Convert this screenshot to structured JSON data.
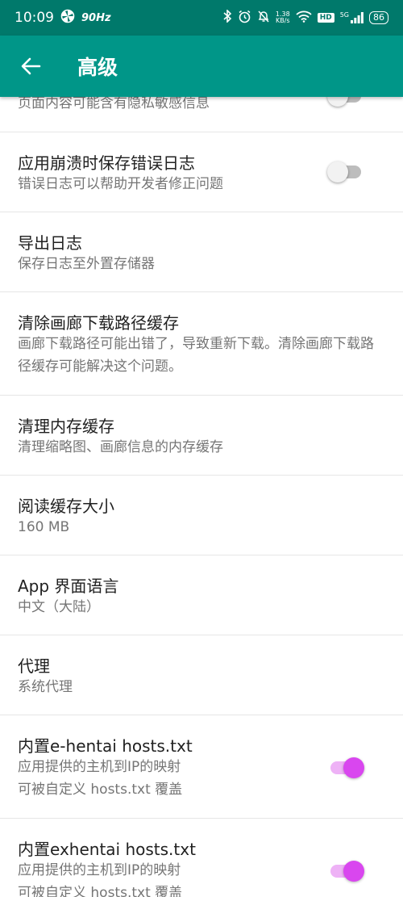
{
  "status_bar": {
    "time": "10:09",
    "refresh_rate": "90Hz",
    "net_speed_value": "1.38",
    "net_speed_unit": "KB/s",
    "hd": "HD",
    "network": "5G",
    "battery": "86"
  },
  "header": {
    "title": "高级"
  },
  "colors": {
    "primary": "#009688",
    "status_bar": "#00796b",
    "accent": "#d946ef"
  },
  "settings": [
    {
      "subtitle": "页面内容可能含有隐私敏感信息",
      "toggle": "off"
    },
    {
      "title": "应用崩溃时保存错误日志",
      "subtitle": "错误日志可以帮助开发者修正问题",
      "toggle": "off"
    },
    {
      "title": "导出日志",
      "subtitle": "保存日志至外置存储器"
    },
    {
      "title": "清除画廊下载路径缓存",
      "subtitle": "画廊下载路径可能出错了，导致重新下载。清除画廊下载路径缓存可能解决这个问题。"
    },
    {
      "title": "清理内存缓存",
      "subtitle": "清理缩略图、画廊信息的内存缓存"
    },
    {
      "title": "阅读缓存大小",
      "subtitle": "160 MB"
    },
    {
      "title": "App 界面语言",
      "subtitle": "中文（大陆）"
    },
    {
      "title": "代理",
      "subtitle": "系统代理"
    },
    {
      "title": "内置e-hentai hosts.txt",
      "subtitle_line1": "应用提供的主机到IP的映射",
      "subtitle_line2": "可被自定义 hosts.txt 覆盖",
      "toggle": "on"
    },
    {
      "title": "内置exhentai hosts.txt",
      "subtitle_line1": "应用提供的主机到IP的映射",
      "subtitle_line2": "可被自定义 hosts.txt 覆盖",
      "toggle": "on"
    }
  ]
}
